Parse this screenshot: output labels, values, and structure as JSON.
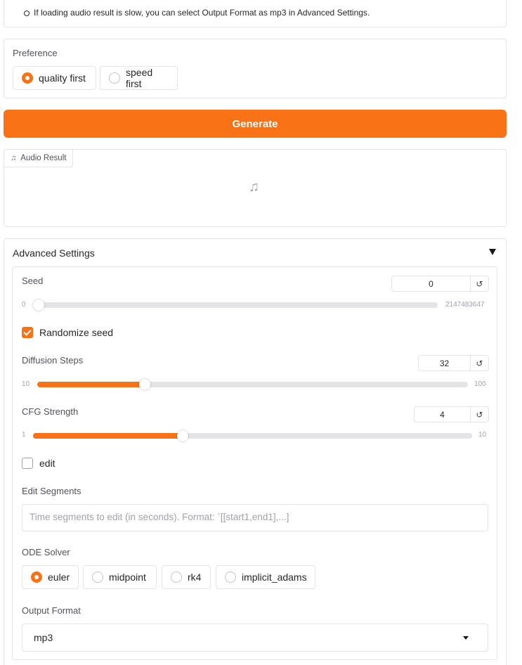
{
  "notes": {
    "item": "If loading audio result is slow, you can select Output Format as mp3 in Advanced Settings."
  },
  "preference": {
    "label": "Preference",
    "options": [
      {
        "label": "quality first",
        "selected": true
      },
      {
        "label": "speed first",
        "selected": false
      }
    ]
  },
  "generate_label": "Generate",
  "audio": {
    "tab_label": "Audio Result",
    "tab_icon": "music-note-icon",
    "placeholder_icon": "music-note-icon"
  },
  "advanced": {
    "title": "Advanced Settings",
    "seed": {
      "label": "Seed",
      "value": "0",
      "min": "0",
      "max": "2147483647",
      "reset_icon": "reset-icon",
      "fraction": 0
    },
    "randomize_seed": {
      "label": "Randomize seed",
      "checked": true
    },
    "diffusion_steps": {
      "label": "Diffusion Steps",
      "value": "32",
      "min": "10",
      "max": "100",
      "fraction": 0.2444
    },
    "cfg_strength": {
      "label": "CFG Strength",
      "value": "4",
      "min": "1",
      "max": "10",
      "fraction": 0.3333
    },
    "edit": {
      "label": "edit",
      "checked": false
    },
    "edit_segments": {
      "label": "Edit Segments",
      "placeholder": "Time segments to edit (in seconds). Format: `[[start1,end1],...]"
    },
    "ode_solver": {
      "label": "ODE Solver",
      "options": [
        {
          "label": "euler",
          "selected": true
        },
        {
          "label": "midpoint",
          "selected": false
        },
        {
          "label": "rk4",
          "selected": false
        },
        {
          "label": "implicit_adams",
          "selected": false
        }
      ]
    },
    "output_format": {
      "label": "Output Format",
      "value": "mp3"
    }
  },
  "colors": {
    "accent": "#f97316",
    "border": "#e4e4e7",
    "track": "#e4e4e7"
  }
}
